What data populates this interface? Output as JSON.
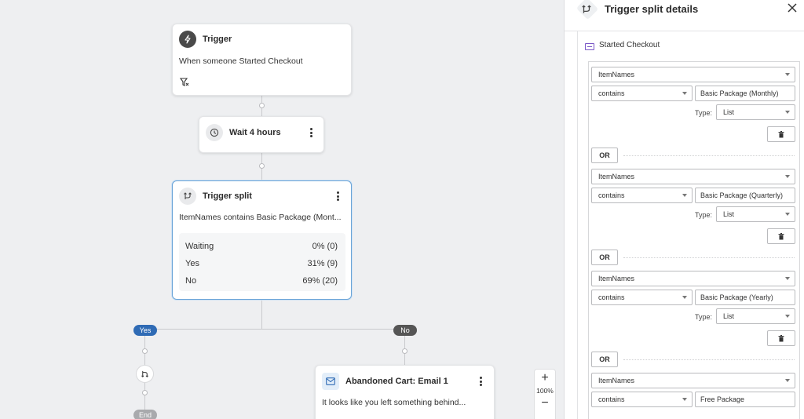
{
  "flow": {
    "trigger": {
      "title": "Trigger",
      "description": "When someone Started Checkout"
    },
    "wait": {
      "label": "Wait 4 hours"
    },
    "split": {
      "title": "Trigger split",
      "description": "ItemNames contains Basic Package (Mont...",
      "stats": [
        {
          "label": "Waiting",
          "value": "0% (0)"
        },
        {
          "label": "Yes",
          "value": "31% (9)"
        },
        {
          "label": "No",
          "value": "69% (20)"
        }
      ]
    },
    "branch_yes": "Yes",
    "branch_no": "No",
    "end_label": "End",
    "email": {
      "title": "Abandoned Cart: Email 1",
      "preview": "It looks like you left something behind..."
    },
    "zoom": {
      "level": "100%",
      "plus": "+",
      "minus": "−"
    }
  },
  "panel": {
    "title": "Trigger split details",
    "event_name": "Started Checkout",
    "or_label": "OR",
    "type_label": "Type:",
    "conditions": [
      {
        "property": "ItemNames",
        "operator": "contains",
        "value": "Basic Package (Monthly)",
        "type": "List"
      },
      {
        "property": "ItemNames",
        "operator": "contains",
        "value": "Basic Package (Quarterly)",
        "type": "List"
      },
      {
        "property": "ItemNames",
        "operator": "contains",
        "value": "Basic Package (Yearly)",
        "type": "List"
      },
      {
        "property": "ItemNames",
        "operator": "contains",
        "value": "Free Package",
        "type": ""
      }
    ]
  },
  "colors": {
    "yes_pill": "#2f6bb5",
    "no_pill": "#555555",
    "end_pill": "#a9aaad",
    "selected_border": "#6aa4d8"
  }
}
